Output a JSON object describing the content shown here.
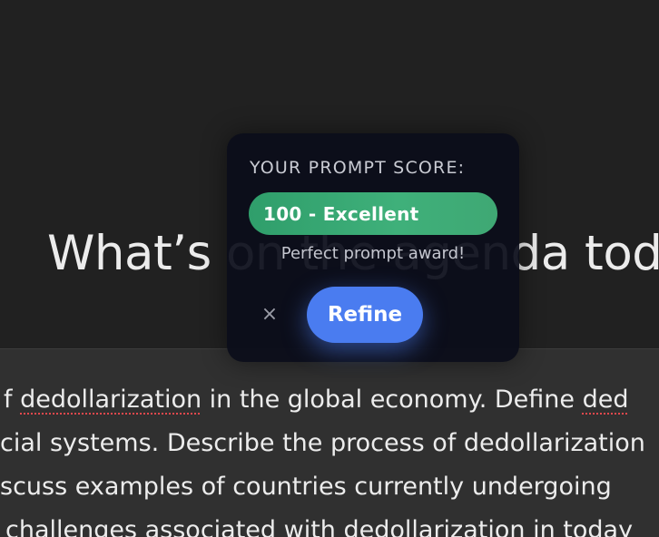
{
  "headline": "What’s on the agenda today",
  "composer": {
    "line1": {
      "pre": "f ",
      "word1": "dedollarization",
      "mid": " in the global economy. Define ",
      "word2": "ded"
    },
    "line2": "cial systems. Describe the process of dedollarization",
    "line3": "scuss examples of countries currently undergoing",
    "line4": "challenges associated with dedollarization in today"
  },
  "popup": {
    "title": "YOUR PROMPT SCORE:",
    "score": "100 - Excellent",
    "message": "Perfect prompt award!",
    "close_glyph": "×",
    "refine_label": "Refine",
    "score_color": "#3fb07a",
    "accent_color": "#4a7cf0"
  }
}
